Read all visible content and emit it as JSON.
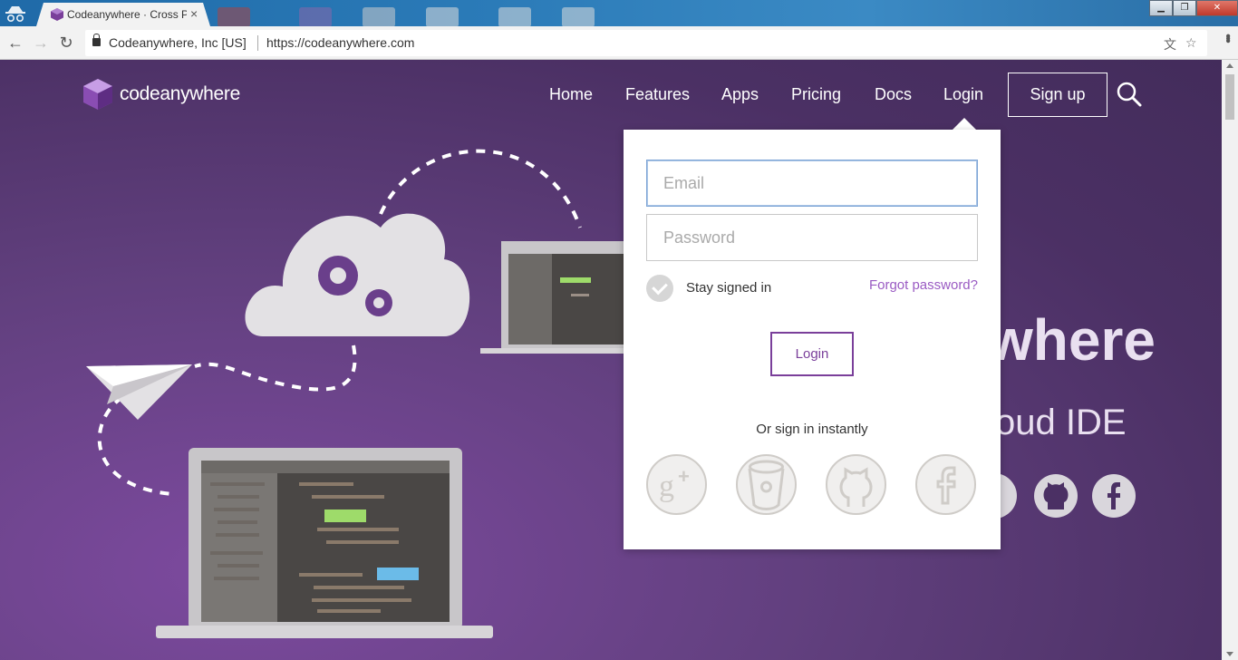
{
  "browser": {
    "tab_title": "Codeanywhere · Cross P",
    "tab_close": "×",
    "org": "Codeanywhere, Inc [US]",
    "url": "https://codeanywhere.com",
    "back": "←",
    "forward": "→",
    "reload": "↻",
    "translate_icon": "文",
    "star_icon": "☆",
    "window_minimize": "▁",
    "window_restore": "❐",
    "window_close": "✕"
  },
  "site": {
    "logo_text": "codeanywhere",
    "nav": {
      "home": "Home",
      "features": "Features",
      "apps": "Apps",
      "pricing": "Pricing",
      "docs": "Docs",
      "login": "Login",
      "signup": "Sign up"
    },
    "hero_title": "where",
    "hero_subtitle": "oud IDE"
  },
  "login_popup": {
    "email_placeholder": "Email",
    "email_value": "",
    "password_placeholder": "Password",
    "stay_signed_in": "Stay signed in",
    "stay_signed_in_checked": true,
    "forgot_password": "Forgot password?",
    "login_button": "Login",
    "or_sign_in": "Or sign in instantly",
    "providers": [
      "google-plus-icon",
      "bitbucket-icon",
      "github-icon",
      "facebook-icon"
    ]
  },
  "colors": {
    "purple_bg": "#4b3064",
    "accent": "#7a3f9a",
    "link": "#9a5bc3"
  }
}
